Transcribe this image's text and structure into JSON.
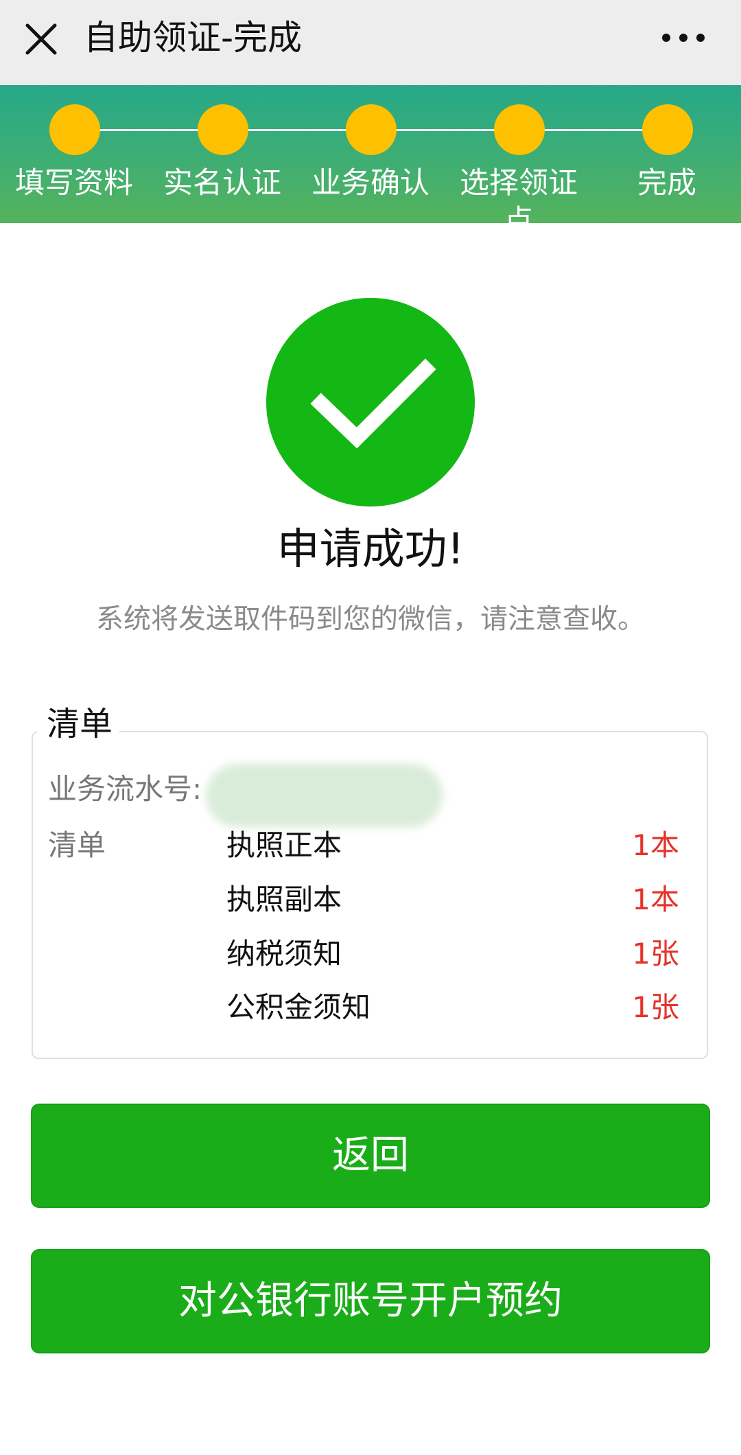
{
  "navbar": {
    "close_icon": "close-icon",
    "title": "自助领证-完成",
    "more_icon": "more-dots-icon",
    "background": "#ededed"
  },
  "steps": {
    "items": [
      {
        "label": "填写资料"
      },
      {
        "label": "实名认证"
      },
      {
        "label": "业务确认"
      },
      {
        "label": "选择领证点"
      },
      {
        "label": "完成"
      }
    ],
    "dot_color": "#ffc000",
    "header_color": "#2fab7f"
  },
  "result": {
    "icon": "check-circle-icon",
    "icon_color": "#1aad19",
    "title": "申请成功!",
    "description": "系统将发送取件码到您的微信，请注意查收。"
  },
  "checklist": {
    "legend": "清单",
    "serial_label": "业务流水号:",
    "list_label": "清单",
    "items": [
      {
        "name": "执照正本",
        "quantity": "1本"
      },
      {
        "name": "执照副本",
        "quantity": "1本"
      },
      {
        "name": "纳税须知",
        "quantity": "1张"
      },
      {
        "name": "公积金须知",
        "quantity": "1张"
      }
    ],
    "quantity_color": "#e5332a"
  },
  "buttons": {
    "back_label": "返回",
    "bank_label": "对公银行账号开户预约",
    "color": "#1aad19"
  }
}
